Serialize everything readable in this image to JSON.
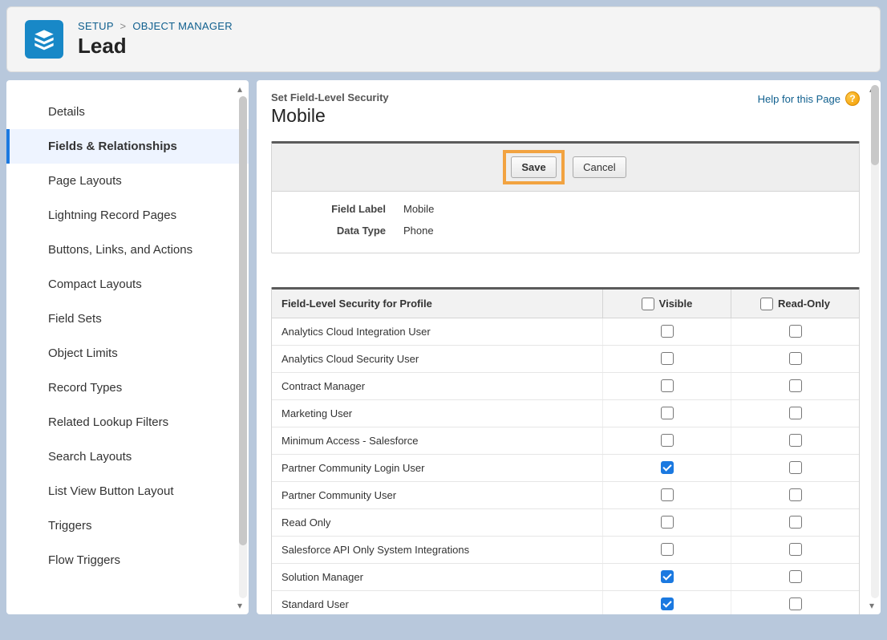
{
  "breadcrumb": {
    "setup": "SETUP",
    "object_manager": "OBJECT MANAGER"
  },
  "page_title": "Lead",
  "sidebar": {
    "items": [
      {
        "label": "Details",
        "active": false
      },
      {
        "label": "Fields & Relationships",
        "active": true
      },
      {
        "label": "Page Layouts",
        "active": false
      },
      {
        "label": "Lightning Record Pages",
        "active": false
      },
      {
        "label": "Buttons, Links, and Actions",
        "active": false
      },
      {
        "label": "Compact Layouts",
        "active": false
      },
      {
        "label": "Field Sets",
        "active": false
      },
      {
        "label": "Object Limits",
        "active": false
      },
      {
        "label": "Record Types",
        "active": false
      },
      {
        "label": "Related Lookup Filters",
        "active": false
      },
      {
        "label": "Search Layouts",
        "active": false
      },
      {
        "label": "List View Button Layout",
        "active": false
      },
      {
        "label": "Triggers",
        "active": false
      },
      {
        "label": "Flow Triggers",
        "active": false
      }
    ]
  },
  "main": {
    "subtitle": "Set Field-Level Security",
    "title": "Mobile",
    "help_link": "Help for this Page",
    "buttons": {
      "save": "Save",
      "cancel": "Cancel"
    },
    "field_label_key": "Field Label",
    "field_label_value": "Mobile",
    "data_type_key": "Data Type",
    "data_type_value": "Phone",
    "security_header": "Field-Level Security for Profile",
    "col_visible": "Visible",
    "col_readonly": "Read-Only",
    "profiles": [
      {
        "name": "Analytics Cloud Integration User",
        "visible": false,
        "readonly": false
      },
      {
        "name": "Analytics Cloud Security User",
        "visible": false,
        "readonly": false
      },
      {
        "name": "Contract Manager",
        "visible": false,
        "readonly": false
      },
      {
        "name": "Marketing User",
        "visible": false,
        "readonly": false
      },
      {
        "name": "Minimum Access - Salesforce",
        "visible": false,
        "readonly": false
      },
      {
        "name": "Partner Community Login User",
        "visible": true,
        "readonly": false
      },
      {
        "name": "Partner Community User",
        "visible": false,
        "readonly": false
      },
      {
        "name": "Read Only",
        "visible": false,
        "readonly": false
      },
      {
        "name": "Salesforce API Only System Integrations",
        "visible": false,
        "readonly": false
      },
      {
        "name": "Solution Manager",
        "visible": true,
        "readonly": false
      },
      {
        "name": "Standard User",
        "visible": true,
        "readonly": false
      }
    ]
  }
}
